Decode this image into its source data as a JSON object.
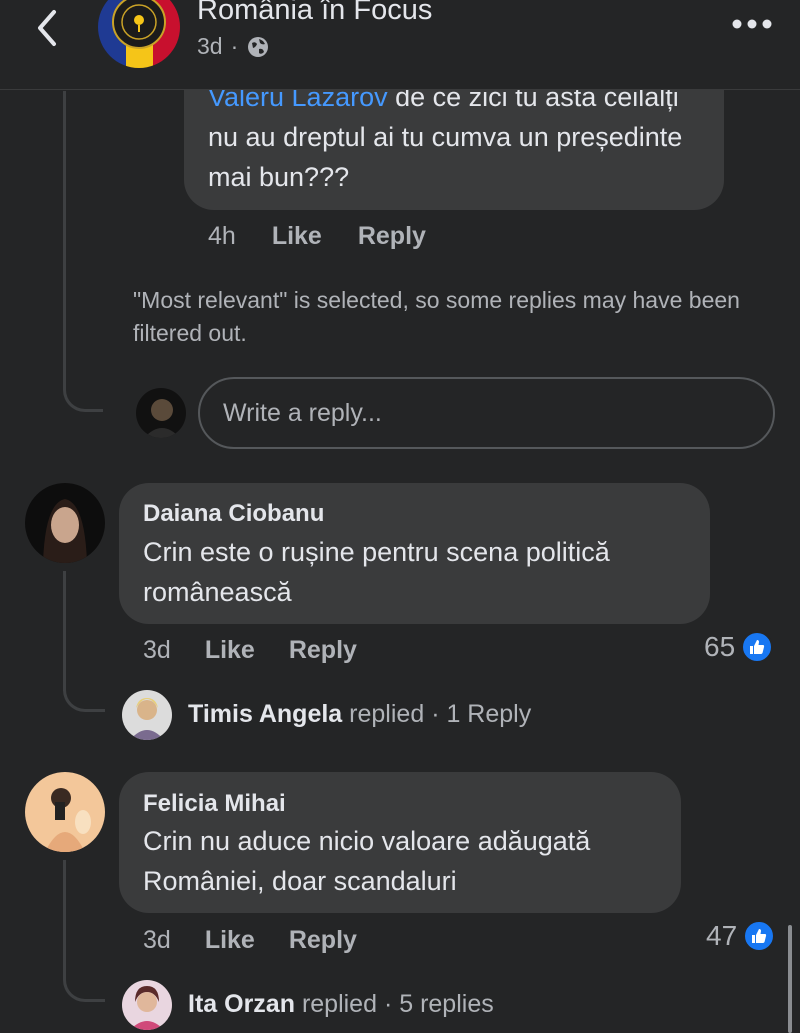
{
  "header": {
    "page_name": "România în Focus",
    "time": "3d",
    "separator": "·",
    "icons": {
      "back": "chevron-left-icon",
      "privacy": "globe-icon",
      "more": "more-horizontal-icon"
    }
  },
  "top_reply": {
    "mention": "Valeru Lazarov",
    "text": " de ce zici tu asta ceilalți nu au dreptul ai tu cumva un președinte mai bun???",
    "time": "4h",
    "like": "Like",
    "reply": "Reply"
  },
  "filter_notice": "\"Most relevant\" is selected, so some replies may have been filtered out.",
  "reply_box": {
    "placeholder": "Write a reply..."
  },
  "comments": [
    {
      "author": "Daiana Ciobanu",
      "text": "Crin este o rușine pentru scena politică românească",
      "time": "3d",
      "like": "Like",
      "reply": "Reply",
      "reactions": "65",
      "replied_by": "Timis Angela",
      "replied_word": "replied",
      "replied_count": "· 1 Reply"
    },
    {
      "author": "Felicia Mihai",
      "text": "Crin nu aduce nicio valoare adăugată României, doar scandaluri",
      "time": "3d",
      "like": "Like",
      "reply": "Reply",
      "reactions": "47",
      "replied_by": "Ita Orzan",
      "replied_word": "replied",
      "replied_count": "· 5 replies"
    }
  ],
  "colors": {
    "background": "#242526",
    "bubble": "#3a3b3c",
    "link": "#4599ff",
    "like_blue": "#1877f2"
  }
}
